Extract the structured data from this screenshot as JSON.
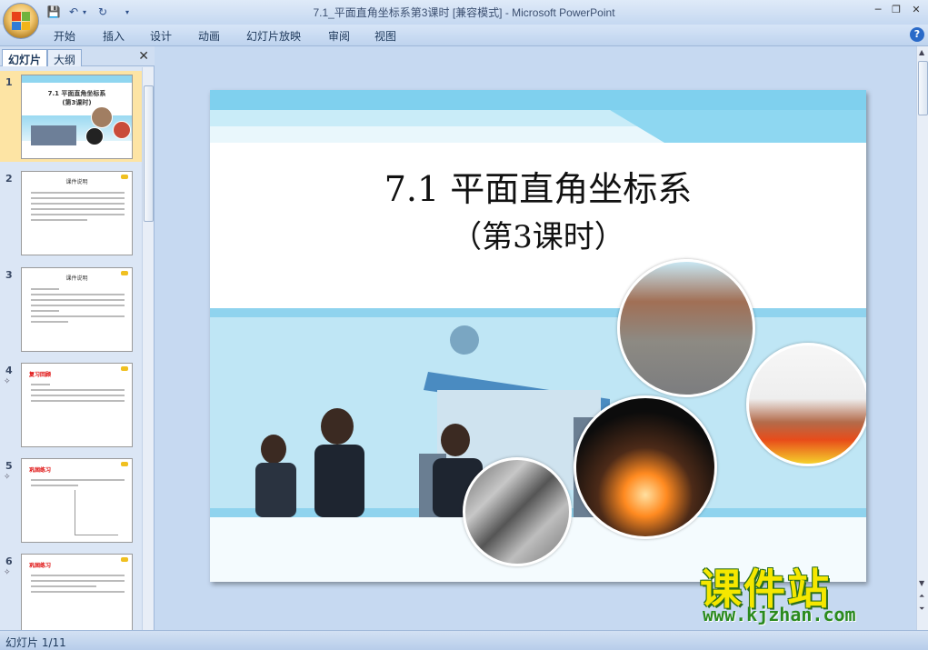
{
  "window": {
    "title": "7.1_平面直角坐标系第3课时 [兼容模式] - Microsoft PowerPoint"
  },
  "ribbon": {
    "tabs": [
      "开始",
      "插入",
      "设计",
      "动画",
      "幻灯片放映",
      "审阅",
      "视图"
    ]
  },
  "panel": {
    "tab_slides": "幻灯片",
    "tab_outline": "大纲",
    "thumbnails": [
      {
        "num": "1",
        "title": "7.1 平面直角坐标系",
        "subtitle": "(第3课时)"
      },
      {
        "num": "2",
        "title": "课件说明"
      },
      {
        "num": "3",
        "title": "课件说明"
      },
      {
        "num": "4",
        "title": "复习回顾"
      },
      {
        "num": "5",
        "title": "巩固练习"
      },
      {
        "num": "6",
        "title": "巩固练习"
      }
    ]
  },
  "slide": {
    "title_line1": "7.1 平面直角坐标系",
    "title_line2": "（第3课时）"
  },
  "status": {
    "text": "幻灯片 1/11"
  },
  "watermark": {
    "cn": "课件站",
    "url": "www.kjzhan.com"
  },
  "colors": {
    "accent": "#2a6ac8",
    "slide_band": "#87d3ef",
    "watermark_yellow": "#f5e700"
  }
}
